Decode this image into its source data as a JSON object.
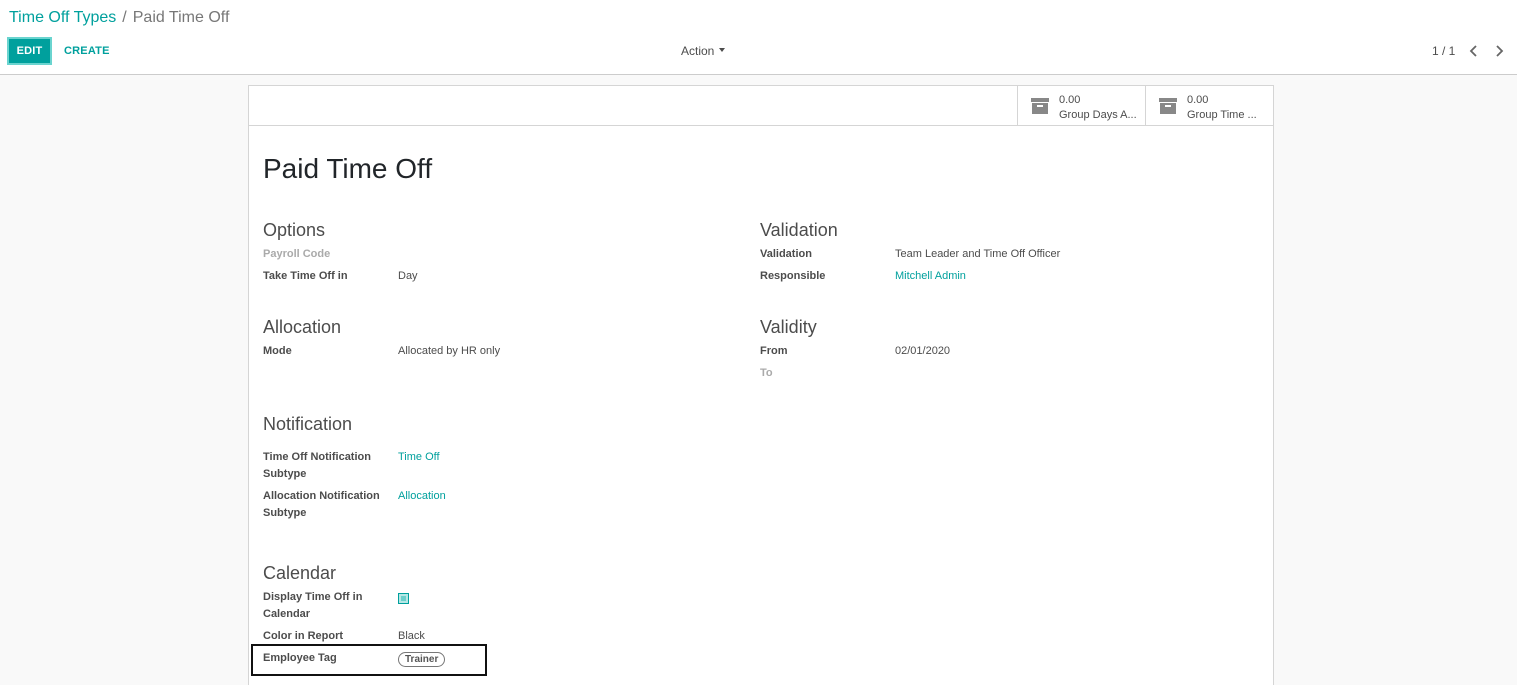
{
  "breadcrumb": {
    "parent": "Time Off Types",
    "separator": "/",
    "current": "Paid Time Off"
  },
  "toolbar": {
    "edit_label": "EDIT",
    "create_label": "CREATE",
    "action_label": "Action"
  },
  "pager": {
    "value": "1 / 1"
  },
  "stat_buttons": [
    {
      "value": "0.00",
      "label": "Group Days A...",
      "icon": "archive-icon"
    },
    {
      "value": "0.00",
      "label": "Group Time ...",
      "icon": "archive-icon"
    }
  ],
  "record": {
    "title": "Paid Time Off"
  },
  "options": {
    "title": "Options",
    "payroll_code_label": "Payroll Code",
    "take_time_off_label": "Take Time Off in",
    "take_time_off_value": "Day"
  },
  "validation": {
    "title": "Validation",
    "validation_label": "Validation",
    "validation_value": "Team Leader and Time Off Officer",
    "responsible_label": "Responsible",
    "responsible_value": "Mitchell Admin"
  },
  "allocation": {
    "title": "Allocation",
    "mode_label": "Mode",
    "mode_value": "Allocated by HR only"
  },
  "validity": {
    "title": "Validity",
    "from_label": "From",
    "from_value": "02/01/2020",
    "to_label": "To"
  },
  "notification": {
    "title": "Notification",
    "time_off_label_1": "Time Off Notification",
    "time_off_label_2": "Subtype",
    "time_off_value": "Time Off",
    "allocation_label_1": "Allocation Notification",
    "allocation_label_2": "Subtype",
    "allocation_value": "Allocation"
  },
  "calendar": {
    "title": "Calendar",
    "display_label_1": "Display Time Off in",
    "display_label_2": "Calendar",
    "display_checked": true,
    "color_label": "Color in Report",
    "color_value": "Black",
    "employee_tag_label": "Employee Tag",
    "employee_tag_value": "Trainer"
  },
  "colors": {
    "accent": "#00a09d",
    "text": "#4c4c4c",
    "muted": "#aaaaaa"
  }
}
